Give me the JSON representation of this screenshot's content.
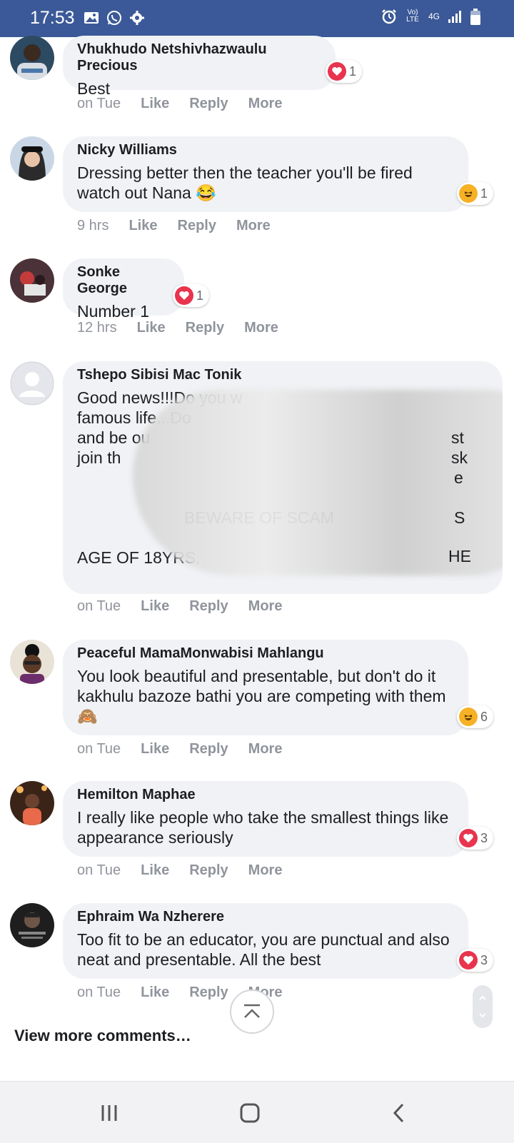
{
  "status_bar": {
    "time": "17:53",
    "left_icons": [
      "image-icon",
      "whatsapp-icon",
      "settings-gear-icon"
    ],
    "right_icons": [
      "alarm-icon",
      "volte-icon",
      "4g-icon",
      "signal-icon",
      "battery-icon"
    ],
    "volte_label": "Vo) LTE",
    "network_label": "4G"
  },
  "actions_labels": {
    "like": "Like",
    "reply": "Reply",
    "more": "More"
  },
  "comments": [
    {
      "author": "Vhukhudo Netshivhazwaulu Precious",
      "text": "Best",
      "time": "on Tue",
      "reaction": {
        "type": "love",
        "count": "1"
      }
    },
    {
      "author": "Nicky Williams",
      "text": "Dressing better then the teacher you'll be fired watch out Nana 😂",
      "time": "9 hrs",
      "reaction": {
        "type": "haha",
        "count": "1"
      }
    },
    {
      "author": "Sonke George",
      "text": "Number 1",
      "time": "12 hrs",
      "reaction": {
        "type": "love",
        "count": "1"
      }
    },
    {
      "author": "Tshepo Sibisi Mac Tonik",
      "text_visible": [
        "Good news!!!Do you w",
        "famous life...Do",
        "and be ou",
        "join th",
        "BEWARE OF SCAM",
        "AGE OF 18YRS."
      ],
      "right_fragments": [
        "st",
        "sk",
        "e",
        "S",
        "HE"
      ],
      "time": "on Tue",
      "redacted": true
    },
    {
      "author": "Peaceful MamaMonwabisi Mahlangu",
      "text": "You look beautiful and presentable, but don't do it kakhulu bazoze bathi you are competing with them 🙈",
      "time": "on Tue",
      "reaction": {
        "type": "haha",
        "count": "6"
      }
    },
    {
      "author": "Hemilton Maphae",
      "text": "I really like people who take the smallest things like appearance seriously",
      "time": "on Tue",
      "reaction": {
        "type": "love",
        "count": "3"
      }
    },
    {
      "author": "Ephraim Wa Nzherere",
      "text": "Too fit to be an educator, you are punctual and also neat and presentable. All the best",
      "time": "on Tue",
      "reaction": {
        "type": "love",
        "count": "3"
      }
    }
  ],
  "view_more": "View more comments…",
  "colors": {
    "status_bar": "#3b5998",
    "bubble": "#f0f2f5",
    "love": "#e8344e",
    "haha": "#f7b125",
    "action_text": "#90949c"
  }
}
